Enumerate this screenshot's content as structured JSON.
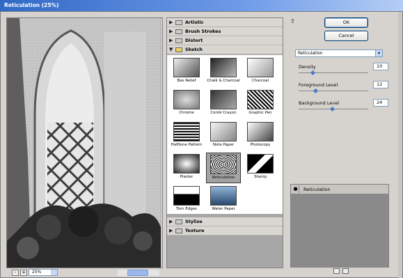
{
  "window": {
    "title": "Reticulation (25%)"
  },
  "preview": {
    "zoom": "25%",
    "minus": "-",
    "plus": "+"
  },
  "gallery": {
    "categories_top": [
      {
        "label": "Artistic",
        "expanded": false
      },
      {
        "label": "Brush Strokes",
        "expanded": false
      },
      {
        "label": "Distort",
        "expanded": false
      },
      {
        "label": "Sketch",
        "expanded": true
      }
    ],
    "sketch_filters": [
      "Bas Relief",
      "Chalk & Charcoal",
      "Charcoal",
      "Chrome",
      "Conté Crayon",
      "Graphic Pen",
      "Halftone Pattern",
      "Note Paper",
      "Photocopy",
      "Plaster",
      "Reticulation",
      "Stamp",
      "Torn Edges",
      "Water Paper"
    ],
    "selected_filter": "Reticulation",
    "categories_bottom": [
      {
        "label": "Stylize",
        "expanded": false
      },
      {
        "label": "Texture",
        "expanded": false
      }
    ]
  },
  "buttons": {
    "ok": "OK",
    "cancel": "Cancel"
  },
  "filter_select": {
    "value": "Reticulation"
  },
  "params": [
    {
      "label": "Density",
      "value": "10",
      "fraction": 0.2
    },
    {
      "label": "Foreground Level",
      "value": "12",
      "fraction": 0.24
    },
    {
      "label": "Background Level",
      "value": "24",
      "fraction": 0.48
    }
  ],
  "layers": [
    {
      "label": "Reticulation"
    }
  ],
  "colors": {
    "titlebar": "#3169c6",
    "accent": "#4a7ac8",
    "panel": "#d6d3ce"
  }
}
